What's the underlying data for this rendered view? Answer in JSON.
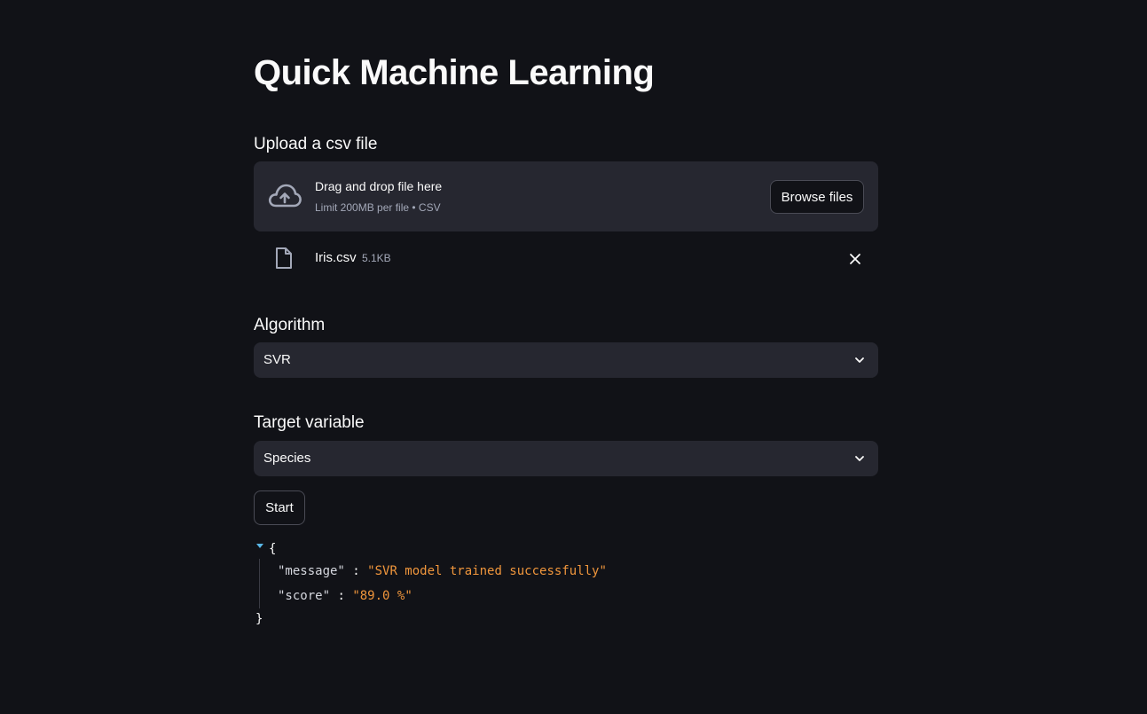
{
  "page": {
    "title": "Quick Machine Learning"
  },
  "upload": {
    "label": "Upload a csv file",
    "drop_text": "Drag and drop file here",
    "limit_text": "Limit 200MB per file • CSV",
    "browse_label": "Browse files",
    "file": {
      "name": "Iris.csv",
      "size": "5.1KB"
    }
  },
  "algorithm": {
    "label": "Algorithm",
    "value": "SVR"
  },
  "target": {
    "label": "Target variable",
    "value": "Species"
  },
  "start_label": "Start",
  "result": {
    "open_brace": "{",
    "close_brace": "}",
    "rows": [
      {
        "key": "\"message\"",
        "value": "\"SVR model trained successfully\""
      },
      {
        "key": "\"score\"",
        "value": "\"89.0 %\""
      }
    ]
  },
  "colors": {
    "background": "#111217",
    "widget": "#262730",
    "string": "#f0963c",
    "accent": "#5ab8e8"
  }
}
